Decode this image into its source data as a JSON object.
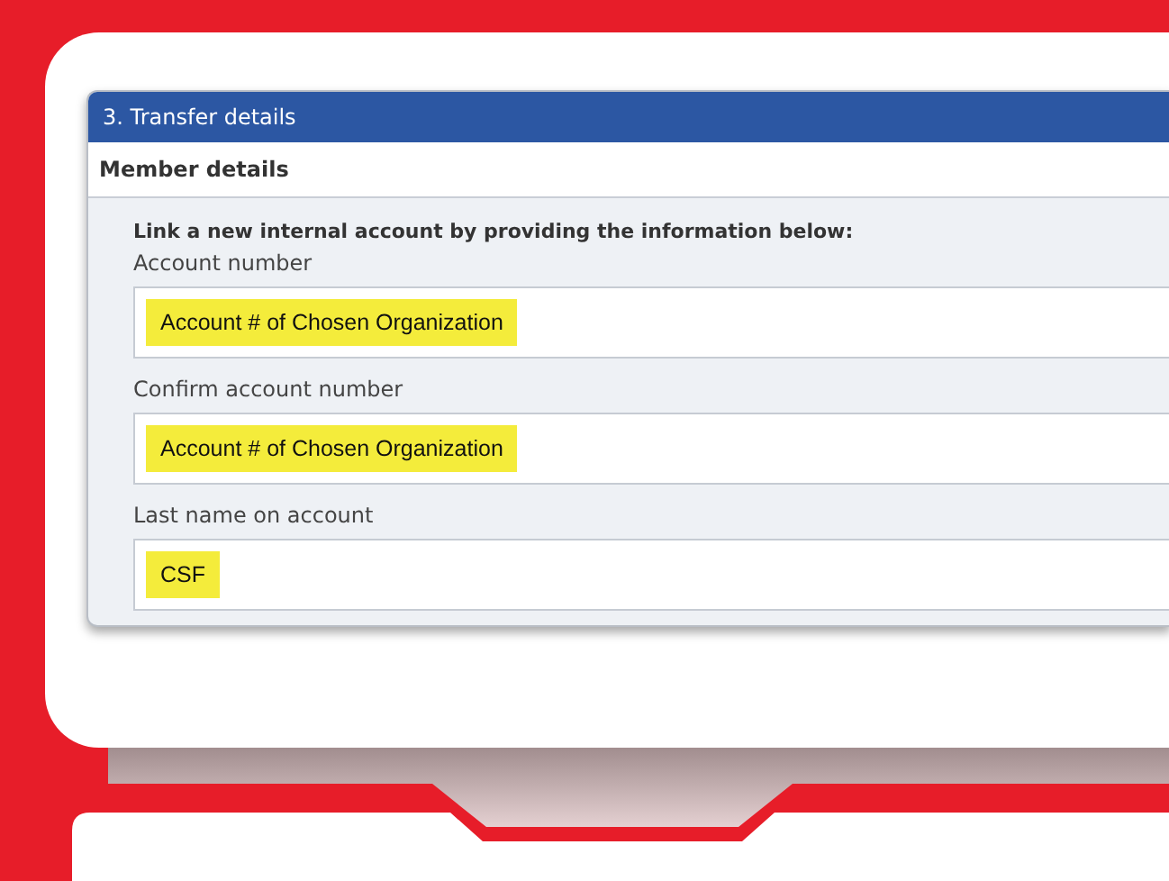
{
  "panel": {
    "title": "3. Transfer details",
    "section": "Member details",
    "instruction": "Link a new internal account by providing the information below:"
  },
  "fields": [
    {
      "label": "Account number",
      "value": "Account # of Chosen Organization",
      "highlighted": true
    },
    {
      "label": "Confirm account number",
      "value": "Account # of Chosen Organization",
      "highlighted": true
    },
    {
      "label": "Last name on account",
      "value": "CSF",
      "highlighted": true
    }
  ]
}
